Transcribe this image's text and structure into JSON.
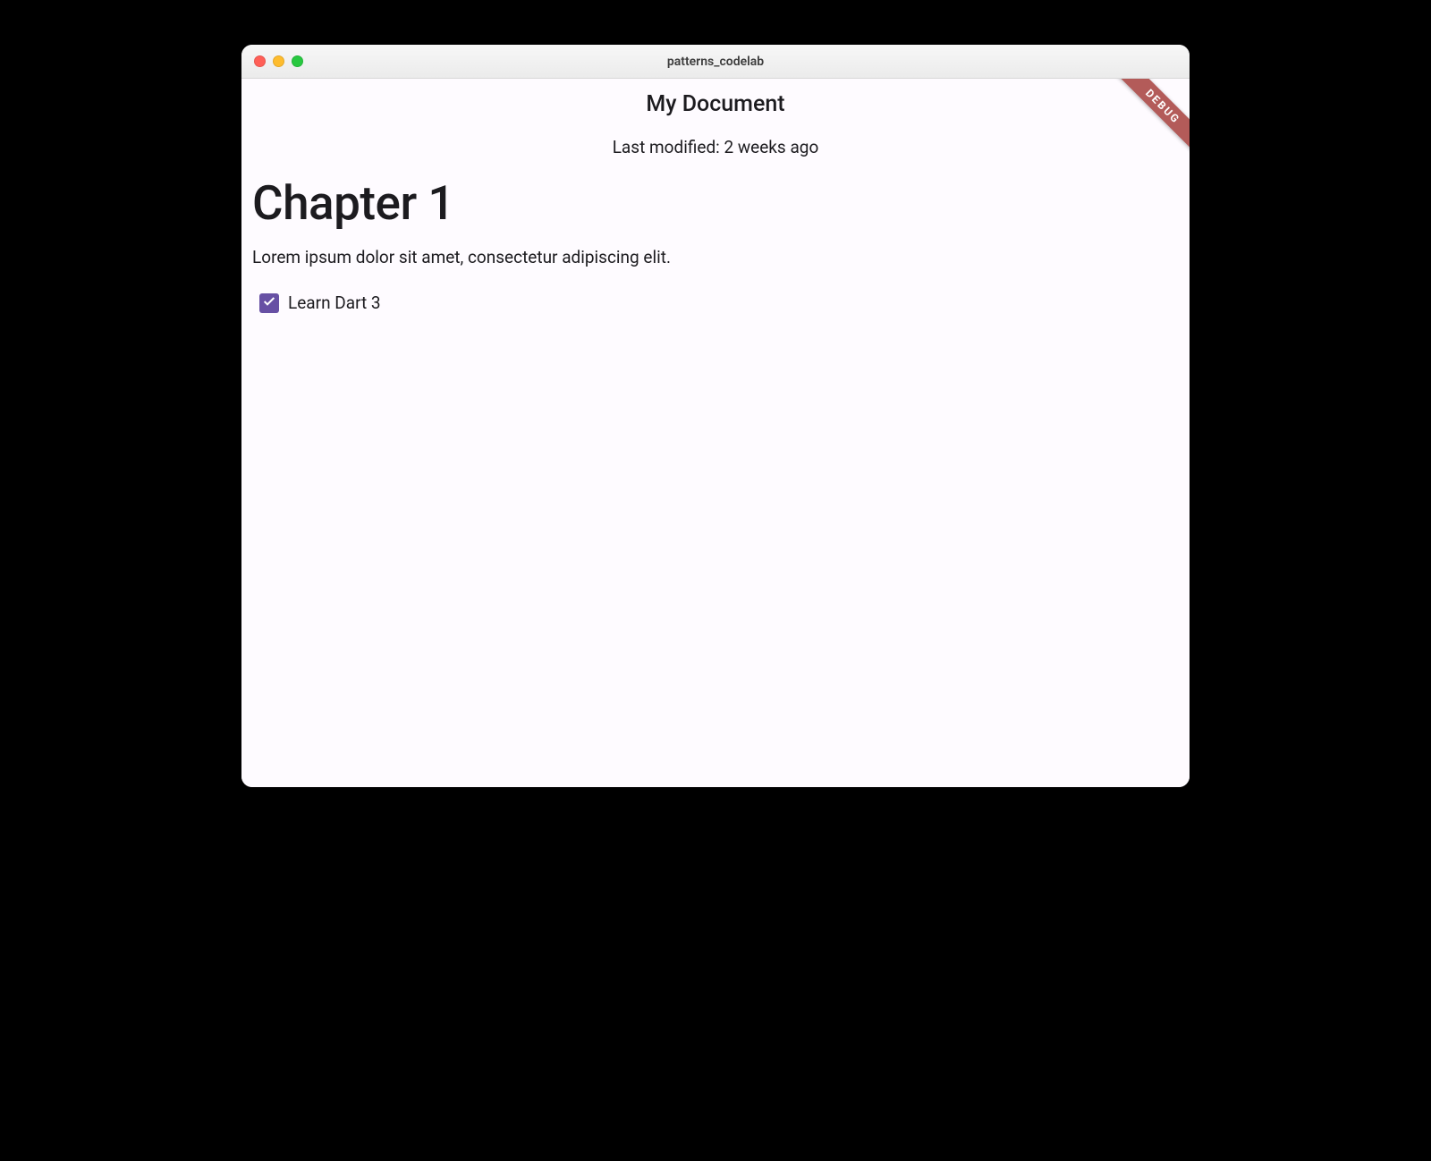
{
  "window": {
    "title": "patterns_codelab"
  },
  "debug_banner": "DEBUG",
  "appbar": {
    "title": "My Document"
  },
  "document": {
    "last_modified": "Last modified: 2 weeks ago",
    "heading": "Chapter 1",
    "body_text": "Lorem ipsum dolor sit amet, consectetur adipiscing elit.",
    "checkbox": {
      "checked": true,
      "label": "Learn Dart 3"
    }
  },
  "colors": {
    "accent": "#6750a4",
    "surface": "#fefbff",
    "debug_banner": "#b35b59"
  }
}
